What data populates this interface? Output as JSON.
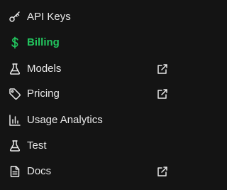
{
  "colors": {
    "background": "#141414",
    "text": "#e8e8e8",
    "active": "#22c55e"
  },
  "nav": {
    "items": [
      {
        "label": "API Keys",
        "icon": "key-icon",
        "active": false,
        "external": false
      },
      {
        "label": "Billing",
        "icon": "dollar-icon",
        "active": true,
        "external": false
      },
      {
        "label": "Models",
        "icon": "flask-icon",
        "active": false,
        "external": true
      },
      {
        "label": "Pricing",
        "icon": "tag-icon",
        "active": false,
        "external": true
      },
      {
        "label": "Usage Analytics",
        "icon": "bar-chart-icon",
        "active": false,
        "external": false
      },
      {
        "label": "Test",
        "icon": "flask-icon",
        "active": false,
        "external": false
      },
      {
        "label": "Docs",
        "icon": "document-icon",
        "active": false,
        "external": true
      }
    ]
  }
}
